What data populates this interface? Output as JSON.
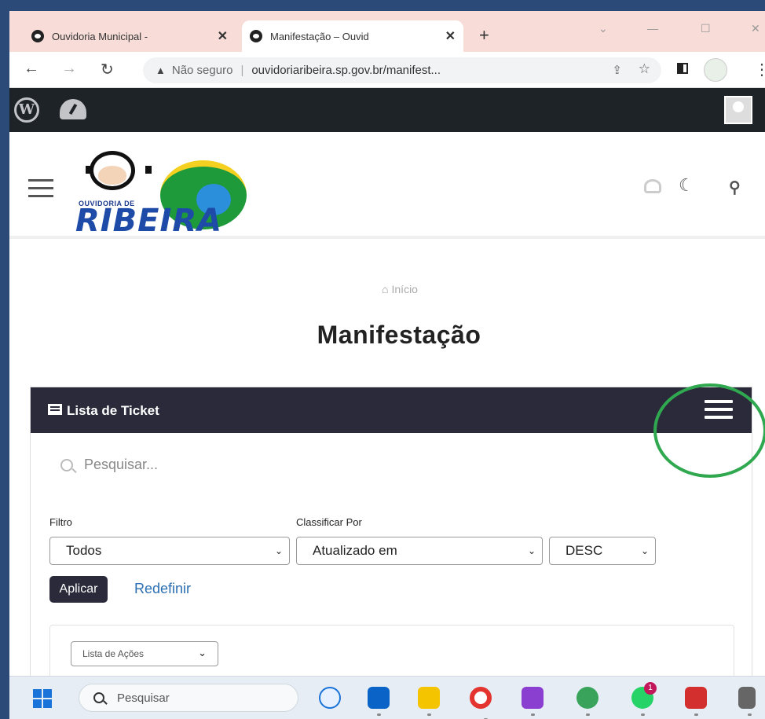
{
  "browser": {
    "tabs": [
      {
        "label": "Ouvidoria Municipal -",
        "active": false
      },
      {
        "label": "Manifestação – Ouvid",
        "active": true
      }
    ],
    "new_tab": "+",
    "url_warning": "Não seguro",
    "url": "ouvidoriaribeira.sp.gov.br/manifest..."
  },
  "site": {
    "logo_small": "OUVIDORIA DE",
    "logo_big": "RIBEIRA"
  },
  "page": {
    "breadcrumb": "Início",
    "title": "Manifestação"
  },
  "panel": {
    "title": "Lista de Ticket",
    "search_placeholder": "Pesquisar...",
    "filter_label": "Filtro",
    "filter_value": "Todos",
    "sort_label": "Classificar Por",
    "sort_value": "Atualizado em",
    "order_value": "DESC",
    "apply_button": "Aplicar",
    "reset_link": "Redefinir",
    "actions_select": "Lista de Ações"
  },
  "taskbar": {
    "search_placeholder": "Pesquisar",
    "whatsapp_badge": "1"
  },
  "colors": {
    "accent_dark": "#2a2a3a",
    "link": "#2c6fb2",
    "annotation": "#2fa84f",
    "wp_bar": "#1d2327"
  },
  "icons": [
    "wordpress-icon",
    "dashboard-icon",
    "hamburger-menu-icon",
    "user-icon",
    "moon-icon",
    "search-icon",
    "list-icon",
    "chevron-down-icon"
  ]
}
